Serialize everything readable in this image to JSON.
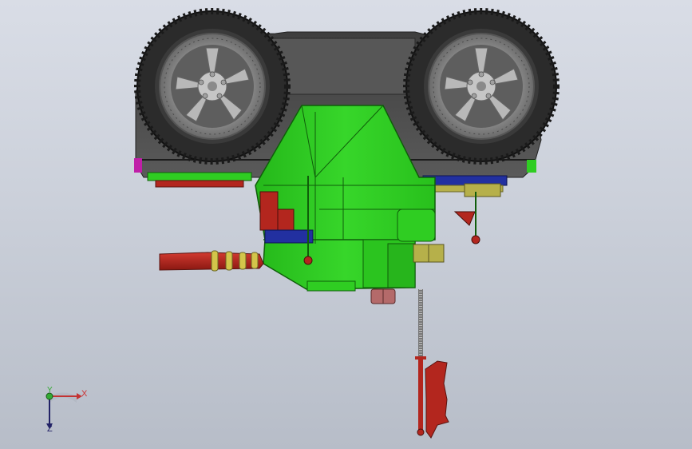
{
  "viewport": {
    "background_top": "#d9dde6",
    "background_bottom": "#b7bdc8"
  },
  "model": {
    "colors": {
      "body_green": "#2fcd22",
      "dark_green": "#1e8f17",
      "chassis_gray": "#4a4a4a",
      "tire_dark": "#2b2b2b",
      "rim_gray": "#8f8f8f",
      "brick_red": "#b3261e",
      "navy_blue": "#2230a0",
      "khaki": "#b6b04a",
      "magenta": "#c01fa8",
      "pink_brown": "#b46a6a"
    },
    "parts": [
      "left-wheel",
      "right-wheel",
      "chassis",
      "green-frame",
      "rear-exhaust-pipe",
      "vertical-spring-rod",
      "red-flag",
      "right-side-antenna"
    ]
  },
  "triad": {
    "x_label": "X",
    "y_label": "Y",
    "z_label": "Z",
    "x_color": "#c33333",
    "y_color": "#33aa33",
    "z_color": "#222266"
  }
}
